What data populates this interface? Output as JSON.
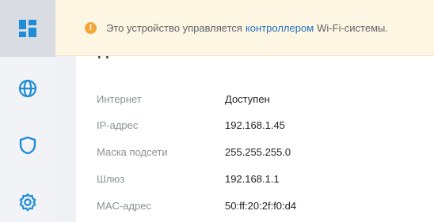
{
  "sidebar": {
    "items": [
      {
        "icon": "dashboard-icon",
        "active": true
      },
      {
        "icon": "globe-icon",
        "active": false
      },
      {
        "icon": "shield-icon",
        "active": false
      },
      {
        "icon": "gear-icon",
        "active": false
      }
    ]
  },
  "colors": {
    "accent": "#1f8dd6",
    "banner_bg": "#fdf6e3",
    "warning": "#f2a73b",
    "link": "#1f6fbf"
  },
  "banner": {
    "icon": "info-icon",
    "icon_glyph": "!",
    "text_before": "Это устройство управляется",
    "link_text": "контроллером",
    "text_after": "Wi-Fi-системы."
  },
  "main": {
    "heading_partial": "Д",
    "rows": [
      {
        "label": "Интернет",
        "value": "Доступен"
      },
      {
        "label": "IP-адрес",
        "value": "192.168.1.45"
      },
      {
        "label": "Маска подсети",
        "value": "255.255.255.0"
      },
      {
        "label": "Шлюз",
        "value": "192.168.1.1"
      },
      {
        "label": "MAC-адрес",
        "value": "50:ff:20:2f:f0:d4"
      }
    ]
  }
}
